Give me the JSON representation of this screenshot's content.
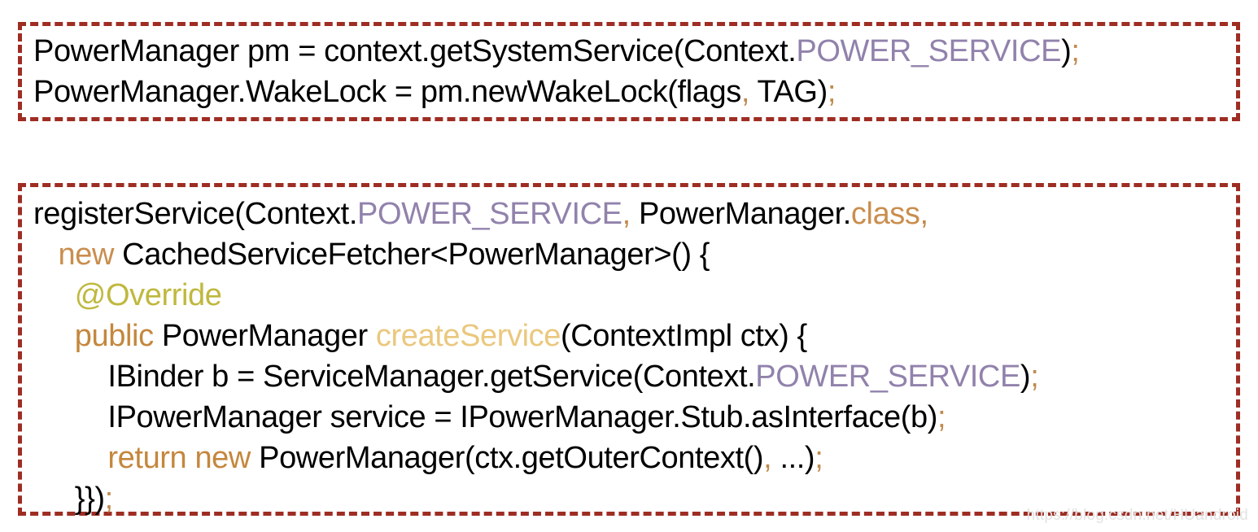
{
  "blocks": [
    {
      "id": "usage-snippet",
      "lines": [
        {
          "indent": "",
          "tokens": [
            {
              "t": "PowerManager pm = context.getSystemService(Context.",
              "k": "plain"
            },
            {
              "t": "POWER_SERVICE",
              "k": "const"
            },
            {
              "t": ")",
              "k": "plain"
            },
            {
              "t": ";",
              "k": "punct"
            }
          ]
        },
        {
          "indent": "",
          "tokens": [
            {
              "t": "PowerManager.WakeLock = pm.newWakeLock(flags",
              "k": "plain"
            },
            {
              "t": ",",
              "k": "punct"
            },
            {
              "t": " TAG)",
              "k": "plain"
            },
            {
              "t": ";",
              "k": "punct"
            }
          ]
        }
      ]
    },
    {
      "id": "register-service-snippet",
      "lines": [
        {
          "indent": "",
          "tokens": [
            {
              "t": "registerService(Context.",
              "k": "plain"
            },
            {
              "t": "POWER_SERVICE",
              "k": "const"
            },
            {
              "t": ",",
              "k": "punct"
            },
            {
              "t": " PowerManager.",
              "k": "plain"
            },
            {
              "t": "class",
              "k": "keyword"
            },
            {
              "t": ",",
              "k": "punct"
            }
          ]
        },
        {
          "indent": "   ",
          "tokens": [
            {
              "t": "new",
              "k": "keyword"
            },
            {
              "t": " CachedServiceFetcher<PowerManager>() {",
              "k": "plain"
            }
          ]
        },
        {
          "indent": "     ",
          "tokens": [
            {
              "t": "@Override",
              "k": "annot"
            }
          ]
        },
        {
          "indent": "     ",
          "tokens": [
            {
              "t": "public",
              "k": "kw-alt"
            },
            {
              "t": " PowerManager ",
              "k": "plain"
            },
            {
              "t": "createService",
              "k": "method"
            },
            {
              "t": "(ContextImpl ctx) {",
              "k": "plain"
            }
          ]
        },
        {
          "indent": "         ",
          "tokens": [
            {
              "t": "IBinder b = ServiceManager.getService(Context.",
              "k": "plain"
            },
            {
              "t": "POWER_SERVICE",
              "k": "const"
            },
            {
              "t": ")",
              "k": "plain"
            },
            {
              "t": ";",
              "k": "punct"
            }
          ]
        },
        {
          "indent": "         ",
          "tokens": [
            {
              "t": "IPowerManager service = IPowerManager.Stub.asInterface(b)",
              "k": "plain"
            },
            {
              "t": ";",
              "k": "punct"
            }
          ]
        },
        {
          "indent": "         ",
          "tokens": [
            {
              "t": "return new",
              "k": "kw-alt"
            },
            {
              "t": " PowerManager(ctx.getOuterContext()",
              "k": "plain"
            },
            {
              "t": ",",
              "k": "punct"
            },
            {
              "t": " ...)",
              "k": "plain"
            },
            {
              "t": ";",
              "k": "punct"
            }
          ]
        },
        {
          "indent": "     ",
          "tokens": [
            {
              "t": "}})",
              "k": "plain"
            },
            {
              "t": ";",
              "k": "punct"
            }
          ]
        }
      ]
    }
  ],
  "watermark": {
    "text": "https://blog.csdn.net/HUandroid"
  },
  "colors": {
    "border": "#9E2D23",
    "constant": "#9182AC",
    "punctuation": "#C08A4E",
    "keyword": "#C98E4E",
    "keyword_alt": "#C4873D",
    "annotation": "#BFB83E",
    "method": "#EAC87E",
    "plain": "#000000",
    "background": "#FFFFFF",
    "watermark": "#E3E3E3"
  }
}
